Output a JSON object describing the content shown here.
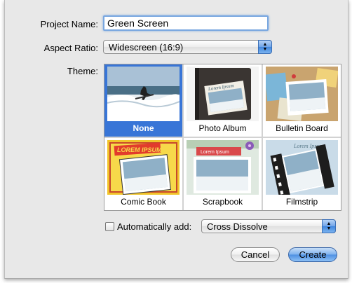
{
  "form": {
    "project_name_label": "Project Name:",
    "project_name_value": "Green Screen",
    "aspect_label": "Aspect Ratio:",
    "aspect_value": "Widescreen (16:9)",
    "theme_label": "Theme:"
  },
  "themes": [
    {
      "name": "None",
      "selected": true
    },
    {
      "name": "Photo Album",
      "selected": false
    },
    {
      "name": "Bulletin Board",
      "selected": false
    },
    {
      "name": "Comic Book",
      "selected": false
    },
    {
      "name": "Scrapbook",
      "selected": false
    },
    {
      "name": "Filmstrip",
      "selected": false
    }
  ],
  "theme_titles": {
    "photo_album": "Lorem Ipsum",
    "comic_book": "LOREM IPSUM",
    "scrapbook": "Lorem Ipsum",
    "filmstrip": "Lorem Ipsum"
  },
  "auto_add": {
    "label": "Automatically add:",
    "checked": false,
    "transition_value": "Cross Dissolve"
  },
  "buttons": {
    "cancel": "Cancel",
    "create": "Create"
  },
  "colors": {
    "selection": "#3875d7",
    "default_button": "#4d8fe2"
  }
}
